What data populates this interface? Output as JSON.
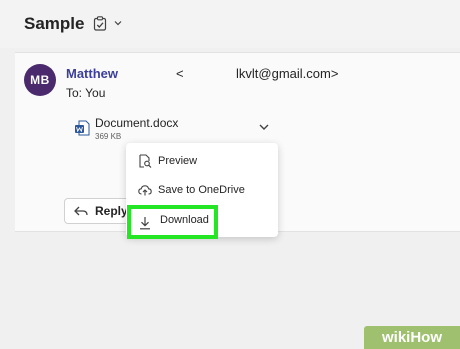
{
  "header": {
    "subject": "Sample",
    "icons": [
      "clipboard-check-icon",
      "chevron-down-icon"
    ]
  },
  "message": {
    "avatar_initials": "MB",
    "sender_name": "Matthew",
    "sender_open": "<",
    "sender_email": "lkvlt@gmail.com>",
    "to_line": "To: You",
    "reply_label": "Reply"
  },
  "attachment": {
    "name": "Document.docx",
    "size": "369 KB",
    "icon": "word-document-icon"
  },
  "context_menu": {
    "items": [
      {
        "label": "Preview",
        "icon": "preview-icon"
      },
      {
        "label": "Save to OneDrive",
        "icon": "cloud-upload-icon"
      },
      {
        "label": "Download",
        "icon": "download-icon"
      }
    ]
  },
  "watermark": {
    "text": "wikiHow"
  },
  "colors": {
    "avatar_bg": "#4a2a6d",
    "sender_name": "#3b3f99",
    "highlight": "#25e625",
    "watermark_bg": "#9fc06f"
  }
}
